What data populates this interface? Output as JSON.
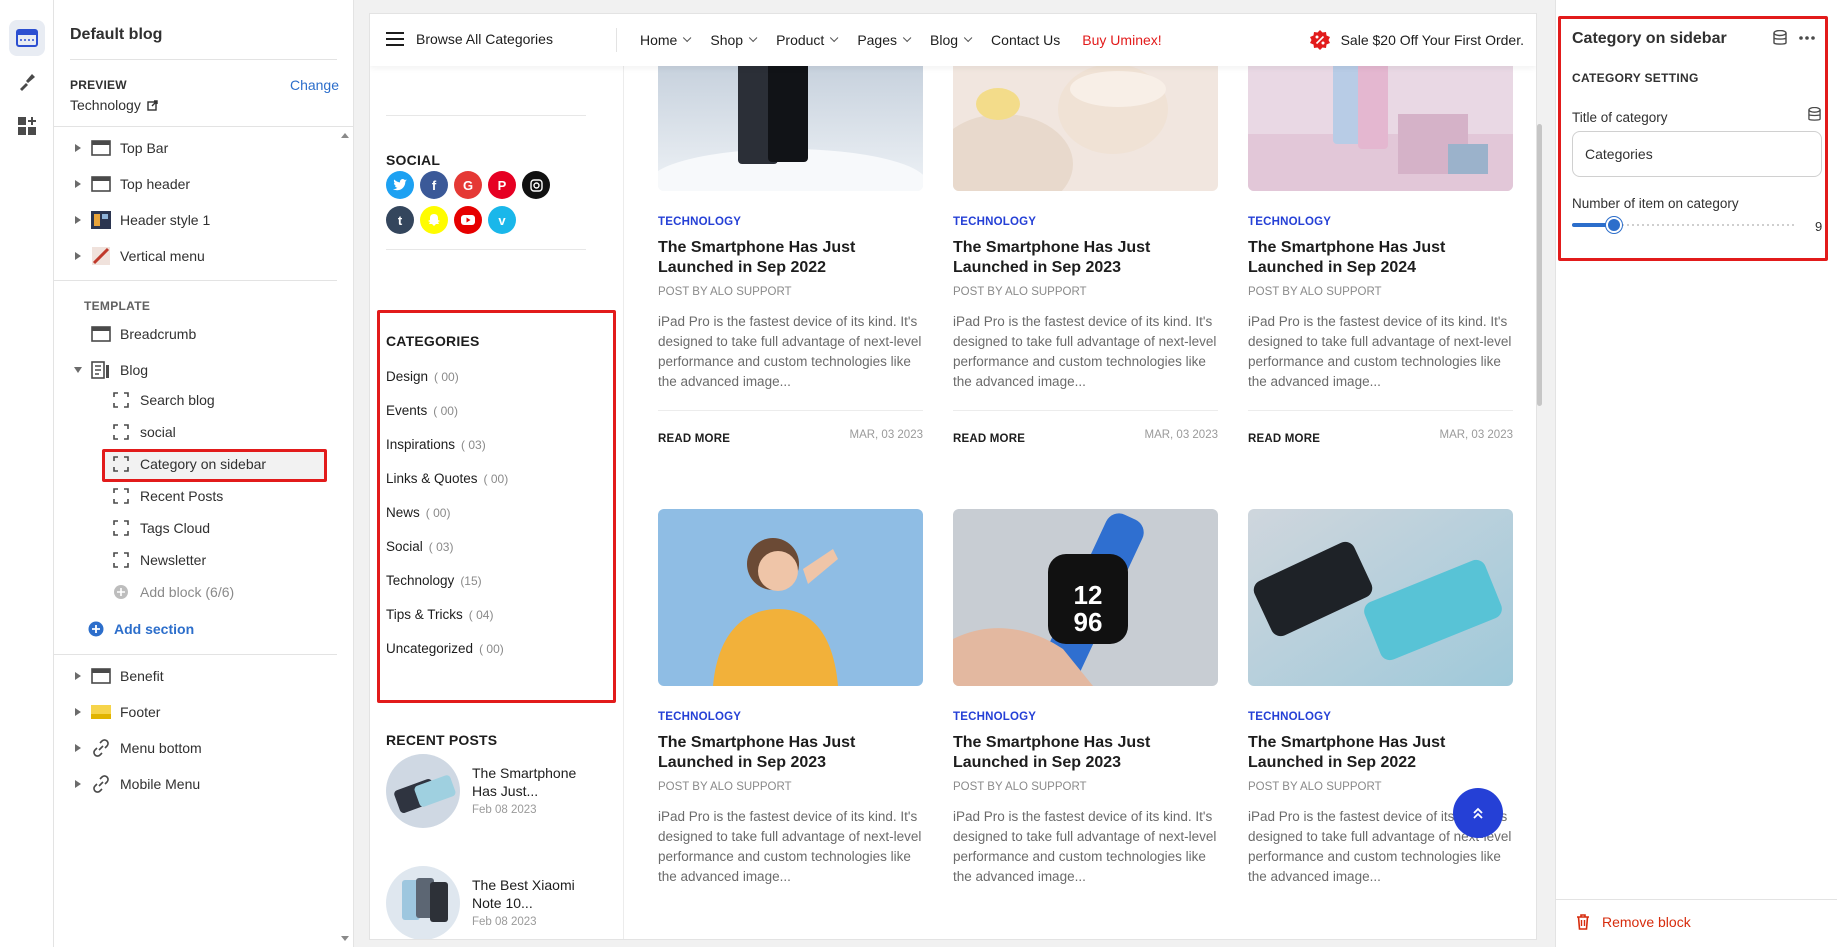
{
  "rail": {
    "icons": [
      "sections-icon",
      "theme-settings-icon",
      "app-blocks-icon"
    ]
  },
  "panel": {
    "title": "Default blog",
    "preview_label": "PREVIEW",
    "preview_change": "Change",
    "preview_value": "Technology",
    "template_label": "TEMPLATE",
    "add_section": "Add section",
    "header_items": [
      "Top Bar",
      "Top header",
      "Header style 1",
      "Vertical menu"
    ],
    "template_items": [
      "Breadcrumb",
      "Blog"
    ],
    "blog_blocks": [
      "Search blog",
      "social",
      "Category on sidebar",
      "Recent Posts",
      "Tags Cloud",
      "Newsletter"
    ],
    "add_block": "Add block (6/6)",
    "footer_items": [
      "Benefit",
      "Footer",
      "Menu bottom",
      "Mobile Menu"
    ]
  },
  "nav": {
    "browse": "Browse All Categories",
    "menu": [
      "Home",
      "Shop",
      "Product",
      "Pages",
      "Blog",
      "Contact Us",
      "Buy Uminex!"
    ],
    "sale": "Sale $20 Off Your First Order."
  },
  "sidebar": {
    "social_title": "SOCIAL",
    "categories_title": "CATEGORIES",
    "categories": [
      {
        "name": "Design",
        "count": "( 00)"
      },
      {
        "name": "Events",
        "count": "( 00)"
      },
      {
        "name": "Inspirations",
        "count": "( 03)"
      },
      {
        "name": "Links & Quotes",
        "count": "( 00)"
      },
      {
        "name": "News",
        "count": "( 00)"
      },
      {
        "name": "Social",
        "count": "( 03)"
      },
      {
        "name": "Technology",
        "count": "(15)"
      },
      {
        "name": "Tips & Tricks",
        "count": "( 04)"
      },
      {
        "name": "Uncategorized",
        "count": "( 00)"
      }
    ],
    "recent_title": "RECENT POSTS",
    "recent": [
      {
        "title": "The Smartphone Has Just...",
        "date": "Feb 08 2023"
      },
      {
        "title": "The Best Xiaomi Note 10...",
        "date": "Feb 08 2023"
      }
    ]
  },
  "posts": [
    {
      "cat": "TECHNOLOGY",
      "title": "The Smartphone Has Just Launched in Sep 2022",
      "by": "POST BY ALO SUPPORT",
      "excerpt": "iPad Pro is the fastest device of its kind. It's designed to take full advantage of next-level performance and custom technologies like the advanced image...",
      "read": "READ MORE",
      "date": "MAR, 03 2023"
    },
    {
      "cat": "TECHNOLOGY",
      "title": "The Smartphone Has Just Launched in Sep 2023",
      "by": "POST BY ALO SUPPORT",
      "excerpt": "iPad Pro is the fastest device of its kind. It's designed to take full advantage of next-level performance and custom technologies like the advanced image...",
      "read": "READ MORE",
      "date": "MAR, 03 2023"
    },
    {
      "cat": "TECHNOLOGY",
      "title": "The Smartphone Has Just Launched in Sep 2024",
      "by": "POST BY ALO SUPPORT",
      "excerpt": "iPad Pro is the fastest device of its kind. It's designed to take full advantage of next-level performance and custom technologies like the advanced image...",
      "read": "READ MORE",
      "date": "MAR, 03 2023"
    },
    {
      "cat": "TECHNOLOGY",
      "title": "The Smartphone Has Just Launched in Sep 2023",
      "by": "POST BY ALO SUPPORT",
      "excerpt": "iPad Pro is the fastest device of its kind. It's designed to take full advantage of next-level performance and custom technologies like the advanced image..."
    },
    {
      "cat": "TECHNOLOGY",
      "title": "The Smartphone Has Just Launched in Sep 2023",
      "by": "POST BY ALO SUPPORT",
      "excerpt": "iPad Pro is the fastest device of its kind. It's designed to take full advantage of next-level performance and custom technologies like the advanced image..."
    },
    {
      "cat": "TECHNOLOGY",
      "title": "The Smartphone Has Just Launched in Sep 2022",
      "by": "POST BY ALO SUPPORT",
      "excerpt": "iPad Pro is the fastest device of its kind. It's designed to take full advantage of next-level performance and custom technologies like the advanced image..."
    }
  ],
  "settings": {
    "title": "Category on sidebar",
    "section": "CATEGORY SETTING",
    "title_label": "Title of category",
    "title_value": "Categories",
    "count_label": "Number of item on category",
    "count_value": "9",
    "remove": "Remove block"
  },
  "colors": {
    "accent": "#2540d6",
    "editor_blue": "#2c6ecb",
    "highlight": "#e21b1b",
    "sale": "#e21b1b"
  }
}
